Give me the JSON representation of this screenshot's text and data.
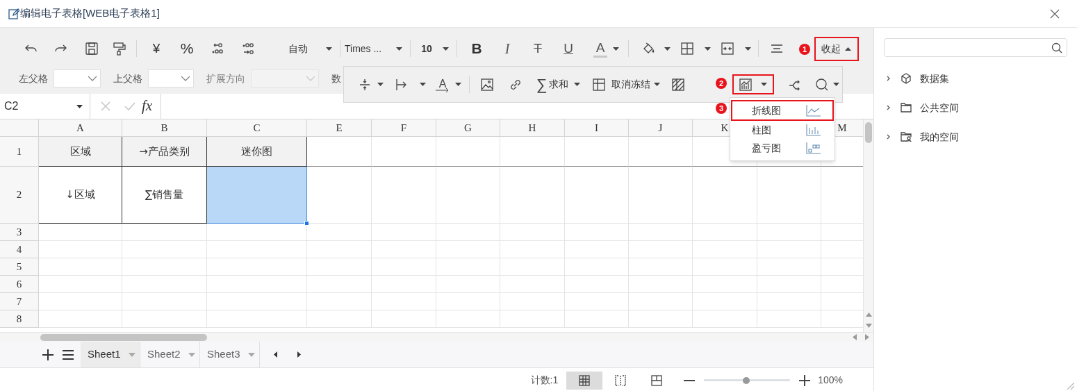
{
  "window": {
    "title": "编辑电子表格[WEB电子表格1]"
  },
  "toolbar": {
    "currency": "¥",
    "percent": "%",
    "number_format": "自动",
    "font_family": "Times ...",
    "font_size": "10",
    "bold": "B",
    "italic": "I",
    "strikethrough": "T",
    "underline": "U",
    "font_color": "A",
    "collapse": "收起",
    "fields": [
      {
        "label": "左父格",
        "disabled": false
      },
      {
        "label": "上父格",
        "disabled": false
      },
      {
        "label": "扩展方向",
        "disabled": true
      }
    ],
    "cut_label": "数"
  },
  "floating_toolbar": {
    "text_direction": "A",
    "sum_symbol": "∑",
    "sum": "求和",
    "freeze": "取消冻结"
  },
  "chart_menu": {
    "items": [
      {
        "label": "折线图",
        "kind": "line"
      },
      {
        "label": "柱图",
        "kind": "bar"
      },
      {
        "label": "盈亏图",
        "kind": "winloss"
      }
    ]
  },
  "annotations": [
    {
      "number": "1"
    },
    {
      "number": "2"
    },
    {
      "number": "3"
    }
  ],
  "formula_bar": {
    "cell_ref": "C2",
    "fx": "fx"
  },
  "sheet": {
    "columns": [
      "A",
      "B",
      "C",
      "E",
      "F",
      "G",
      "H",
      "I",
      "J",
      "K",
      "M"
    ],
    "rows": [
      "1",
      "2",
      "3",
      "4",
      "5",
      "6",
      "7",
      "8"
    ],
    "cells": [
      [
        {
          "text": "区域",
          "selected": false
        },
        {
          "text": "→产品类别",
          "selected": false
        },
        {
          "text": "迷你图",
          "selected": false
        }
      ],
      [
        {
          "text": "↓区域",
          "selected": false
        },
        {
          "text": "∑销售量",
          "selected": false
        },
        {
          "selected": true
        }
      ]
    ]
  },
  "sheet_tabs": [
    {
      "label": "Sheet1",
      "selected": true
    },
    {
      "label": "Sheet2",
      "selected": false
    },
    {
      "label": "Sheet3",
      "selected": false
    }
  ],
  "status_bar": {
    "count": "计数:1",
    "view_modes": [
      {
        "selected": true
      },
      {
        "selected": false
      },
      {
        "selected": false
      }
    ],
    "zoom": {
      "level": 0.49,
      "reading": "100%"
    }
  },
  "sidebar": {
    "tree": [
      {
        "label": "数据集",
        "kind": "dataset",
        "expanded": false
      },
      {
        "label": "公共空间",
        "kind": "folder",
        "expanded": false
      },
      {
        "label": "我的空间",
        "kind": "user-folder",
        "expanded": false
      }
    ]
  }
}
